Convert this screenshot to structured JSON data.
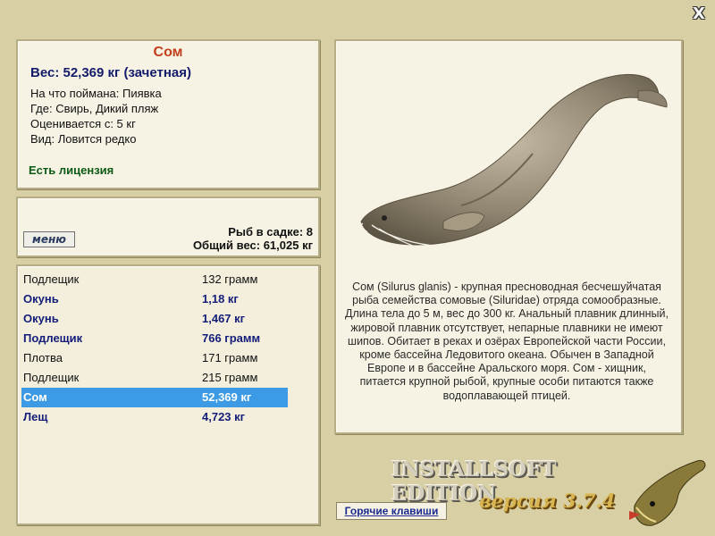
{
  "fish": {
    "name": "Сом",
    "weight": "Вес: 52,369 кг (зачетная)",
    "caught_on": "На что поймана: Пиявка",
    "location": "Где: Свирь, Дикий пляж",
    "scored_from": "Оценивается с: 5 кг",
    "kind": "Вид: Ловится редко",
    "license": "Есть лицензия"
  },
  "summary": {
    "menu_label": "меню",
    "count": "Рыб в садке: 8",
    "total": "Общий вес: 61,025 кг"
  },
  "catch_list": [
    {
      "name": "Подлещик",
      "weight": "132 грамм",
      "bold": false,
      "selected": false
    },
    {
      "name": "Окунь",
      "weight": "1,18 кг",
      "bold": true,
      "selected": false
    },
    {
      "name": "Окунь",
      "weight": "1,467 кг",
      "bold": true,
      "selected": false
    },
    {
      "name": "Подлещик",
      "weight": "766 грамм",
      "bold": true,
      "selected": false
    },
    {
      "name": "Плотва",
      "weight": "171 грамм",
      "bold": false,
      "selected": false
    },
    {
      "name": "Подлещик",
      "weight": "215 грамм",
      "bold": false,
      "selected": false
    },
    {
      "name": "Сом",
      "weight": "52,369 кг",
      "bold": true,
      "selected": true
    },
    {
      "name": "Лещ",
      "weight": "4,723 кг",
      "bold": true,
      "selected": false
    }
  ],
  "description": "Сом (Silurus glanis) - крупная пресноводная бесчешуйчатая рыба семейства сомовые (Siluridae) отряда сомообразные. Длина тела до 5 м, вес до 300 кг. Анальный плавник длинный, жировой плавник отсутствует, непарные плавники не имеют шипов. Обитает в реках и озёрах Европейской части России, кроме бассейна Ледовитого океана. Обычен в Западной Европе и в бассейне Аральского моря. Сом - хищник, питается крупной рыбой, крупные особи питаются также водоплавающей птицей.",
  "hotkeys_label": "Горячие клавиши",
  "brand": "INSTALLSOFT EDITION",
  "version": "версия 3.7.4",
  "close_label": "X",
  "colors": {
    "background": "#d8cfa4",
    "title": "#c0401b",
    "weight": "#131b6b",
    "license": "#0c5a15",
    "selection": "#3c9be4"
  }
}
